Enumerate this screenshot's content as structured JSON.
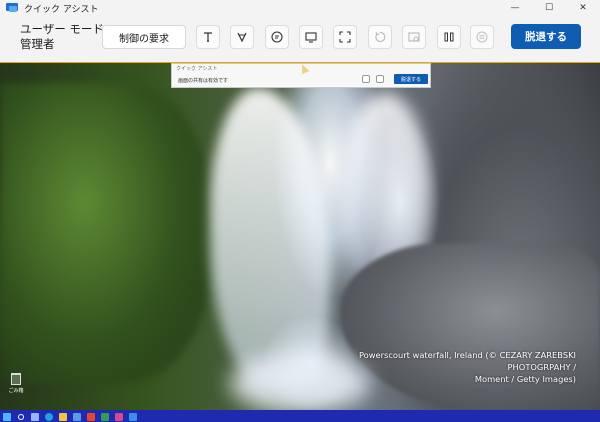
{
  "window": {
    "title": "クイック アシスト",
    "minimize": "—",
    "maximize": "☐",
    "close": "✕"
  },
  "toolbar": {
    "mode_line1": "ユーザー モード:",
    "mode_line2": "管理者",
    "control_button": "制御の要求",
    "leave_button": "脱退する",
    "icons": [
      "laser-pointer-icon",
      "annotate-icon",
      "chat-icon",
      "select-monitor-icon",
      "fullscreen-icon",
      "restart-icon",
      "task-manager-icon",
      "pause-icon",
      "more-options-icon"
    ]
  },
  "remote": {
    "mini_window": {
      "title": "クイック アシスト",
      "text": "画面の共有は有効です",
      "button": "脱退する"
    },
    "caption_line1": "Powerscourt waterfall, Ireland (© CEZARY ZAREBSKI PHOTOGRPAHY /",
    "caption_line2": "Moment / Getty Images)",
    "desktop_icon_label": "ごみ箱"
  },
  "colors": {
    "accent": "#0f5cb3",
    "session_border": "#f0a800",
    "taskbar": "#1e2ab0"
  }
}
